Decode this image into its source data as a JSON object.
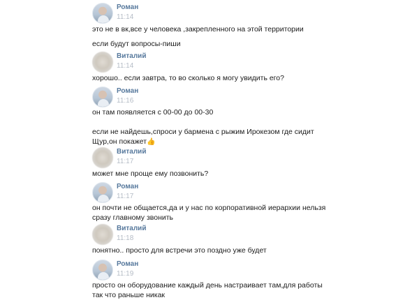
{
  "messages": [
    {
      "type": "header",
      "author": "Роман",
      "avatar": "roman",
      "time": "11:14"
    },
    {
      "type": "text",
      "text": "это не в вк,все у человека ,закрепленного на этой территории"
    },
    {
      "type": "text",
      "text": "если будут вопросы-пиши"
    },
    {
      "type": "header",
      "author": "Виталий",
      "avatar": "vitaliy",
      "time": "11:14"
    },
    {
      "type": "text",
      "text": "хорошо.. если завтра, то во сколько я могу увидить его?"
    },
    {
      "type": "header",
      "author": "Роман",
      "avatar": "roman",
      "time": "11:16"
    },
    {
      "type": "text",
      "text": "он там появляется с 00-00 до 00-30"
    },
    {
      "type": "text",
      "text": "если не найдешь,спроси у бармена с рыжим Ирокезом где сидит\nЩур,он покажет",
      "emoji": "👍"
    },
    {
      "type": "header",
      "author": "Виталий",
      "avatar": "vitaliy",
      "time": "11:17"
    },
    {
      "type": "text",
      "text": "может мне проще ему позвонить?"
    },
    {
      "type": "header",
      "author": "Роман",
      "avatar": "roman",
      "time": "11:17"
    },
    {
      "type": "text",
      "text": "он почти не общается,да и у нас по корпоративной иерархии нельзя\nсразу главному звонить"
    },
    {
      "type": "header",
      "author": "Виталий",
      "avatar": "vitaliy",
      "time": "11:18"
    },
    {
      "type": "text",
      "text": "понятно.. просто для встречи это поздно уже будет"
    },
    {
      "type": "header",
      "author": "Роман",
      "avatar": "roman",
      "time": "11:19"
    },
    {
      "type": "text",
      "text": "просто он оборудование каждый день настраивает там,для работы\nтак что раньше никак"
    }
  ]
}
